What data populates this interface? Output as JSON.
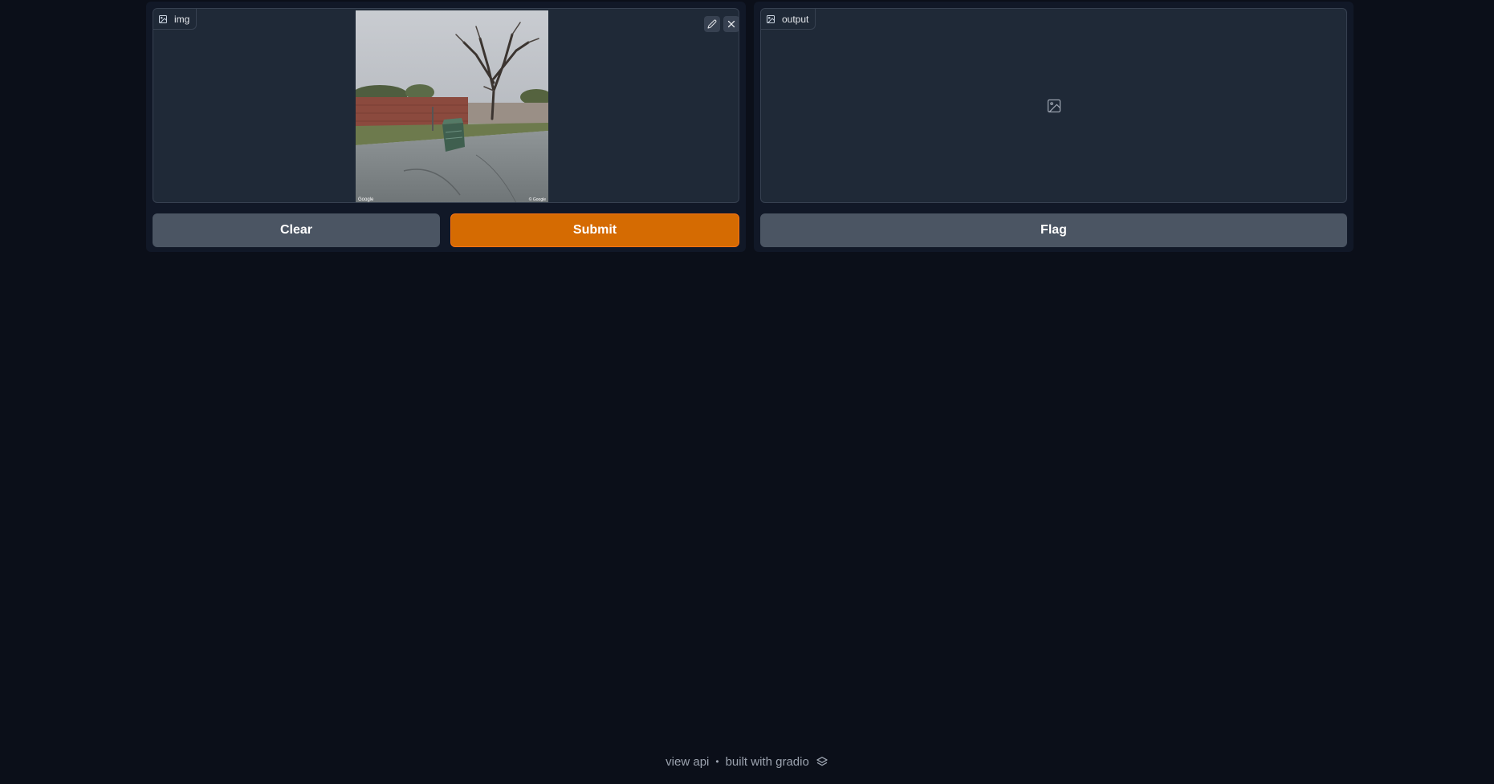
{
  "input": {
    "label": "img",
    "photo_watermark_left": "Google",
    "photo_watermark_right": "© Google"
  },
  "output": {
    "label": "output"
  },
  "buttons": {
    "clear": "Clear",
    "submit": "Submit",
    "flag": "Flag"
  },
  "footer": {
    "view_api": "view api",
    "separator": "•",
    "built_with": "built with gradio"
  },
  "icons": {
    "image_icon": "image-icon",
    "edit_icon": "pencil-icon",
    "close_icon": "close-icon",
    "gradio_logo": "gradio-logo-icon"
  },
  "colors": {
    "background": "#0b0f19",
    "panel": "#111827",
    "box": "#1f2937",
    "primary": "#d56b02",
    "secondary": "#4b5563"
  }
}
